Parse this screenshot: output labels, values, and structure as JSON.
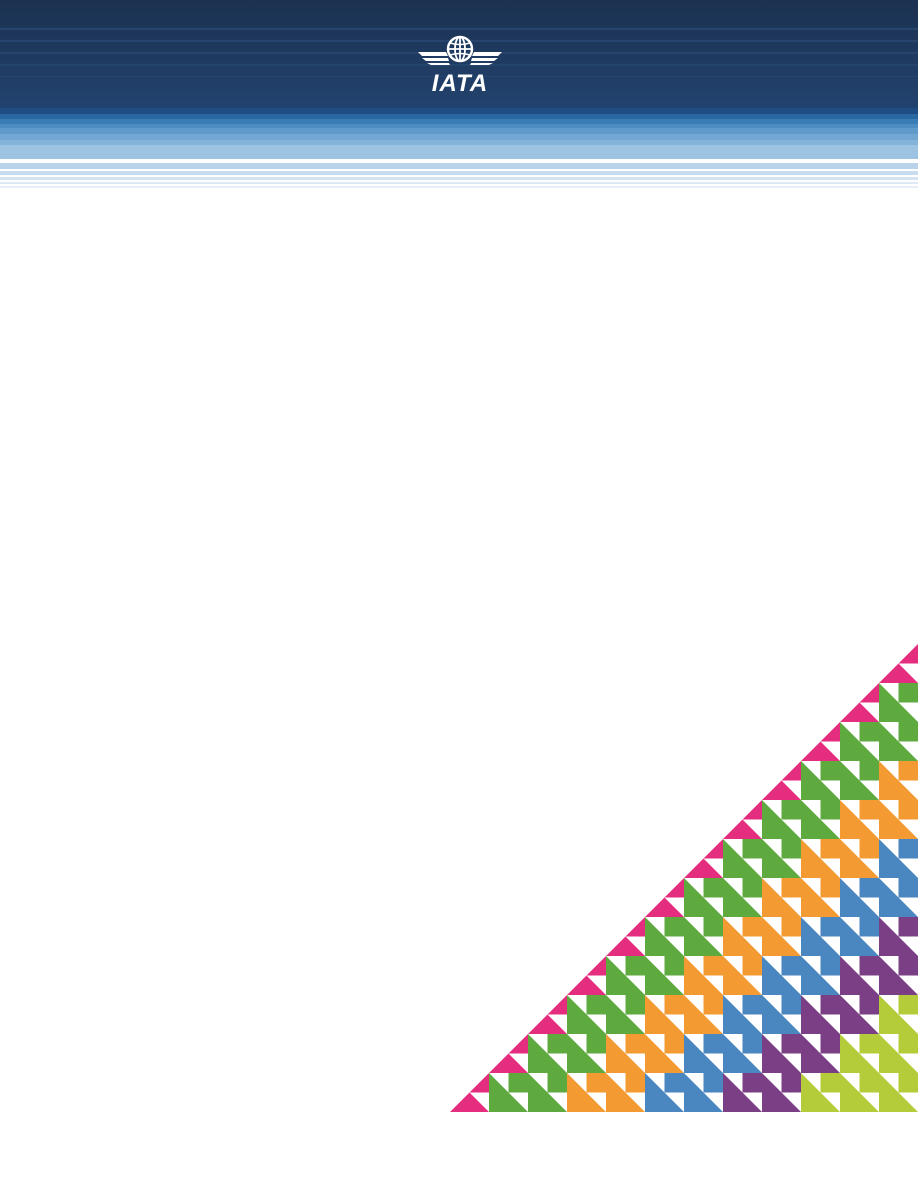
{
  "brand": {
    "name": "IATA",
    "colors": {
      "navy": "#1d3557",
      "band_mid": "#2f6aa0",
      "band_light": "#8cb8dd",
      "band_pale": "#c9def0"
    }
  },
  "logo": {
    "icon": "globe-wings-icon",
    "text": "IATA"
  },
  "pattern": {
    "icon": "triangle-mosaic-graphic",
    "colors": [
      "#e52d7f",
      "#5faa3f",
      "#f39a32",
      "#4a86bf",
      "#7b3f86",
      "#b5cc3a"
    ]
  }
}
